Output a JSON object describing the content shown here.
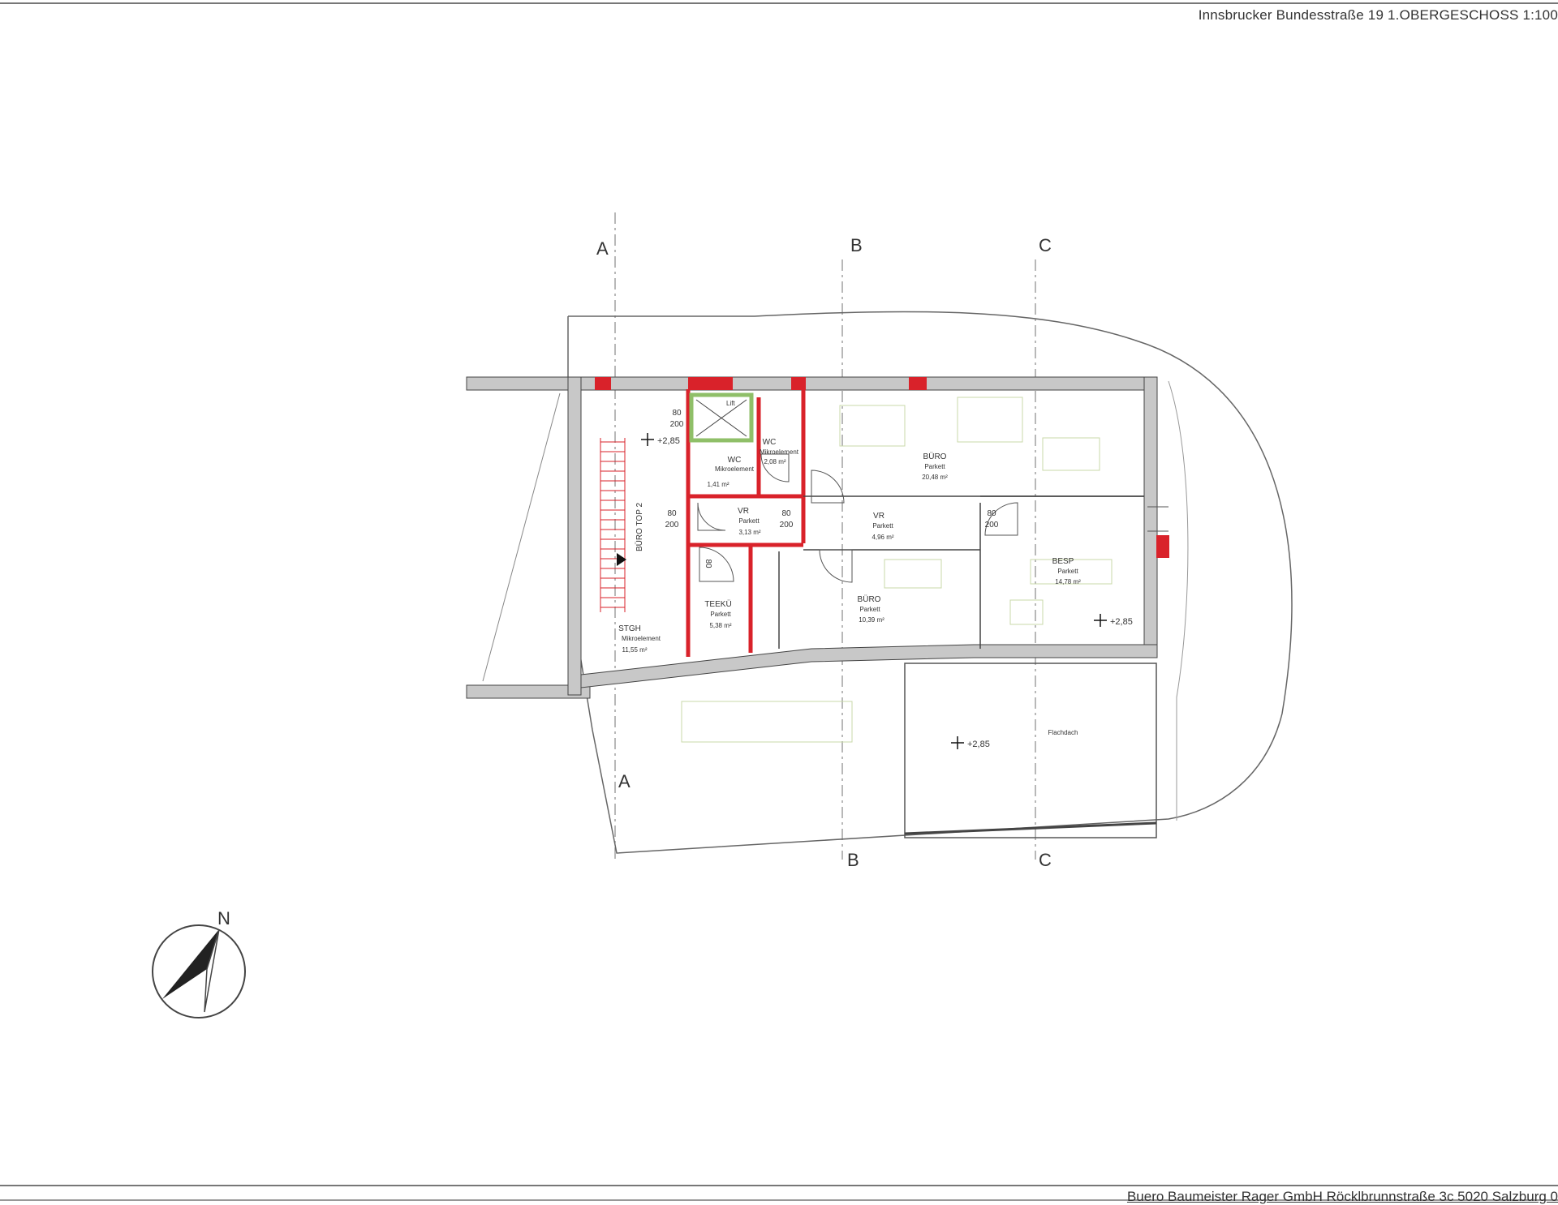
{
  "header": {
    "text": "Innsbrucker Bundesstraße 19  1.OBERGESCHOSS 1:100"
  },
  "footer": {
    "text": "Buero Baumeister Rager GmbH Röcklbrunnstraße 3c  5020 Salzburg  0"
  },
  "section_marks": {
    "a": "A",
    "b": "B",
    "c": "C"
  },
  "unit_label": "BÜRO TOP 2",
  "rooms": {
    "lift": {
      "name": "Lift"
    },
    "wc1": {
      "name": "WC",
      "floor": "Mikroelement",
      "area": "1,41 m²"
    },
    "wc2": {
      "name": "WC",
      "floor": "Mikroelement",
      "area": "2,08 m²"
    },
    "buero1": {
      "name": "BÜRO",
      "floor": "Parkett",
      "area": "20,48 m²"
    },
    "vr1": {
      "name": "VR",
      "floor": "Parkett",
      "area": "3,13 m²"
    },
    "vr2": {
      "name": "VR",
      "floor": "Parkett",
      "area": "4,96 m²"
    },
    "besp": {
      "name": "BESP",
      "floor": "Parkett",
      "area": "14,78 m²"
    },
    "teeku": {
      "name": "TEEKÜ",
      "floor": "Parkett",
      "area": "5,38 m²"
    },
    "buero2": {
      "name": "BÜRO",
      "floor": "Parkett",
      "area": "10,39 m²"
    },
    "stgh": {
      "name": "STGH",
      "floor": "Mikroelement",
      "area": "11,55 m²"
    },
    "flachdach": {
      "name": "Flachdach"
    }
  },
  "door_labels": {
    "d1_top": "80",
    "d1_bot": "200",
    "d2_top": "80",
    "d2_bot": "200",
    "d3_top": "80",
    "d3_bot": "200",
    "d4_top": "80",
    "d4_bot": "200",
    "d5": "80"
  },
  "levels": {
    "l1": "+2,85",
    "l2": "+2,85",
    "l3": "+2,85"
  },
  "north": {
    "label": "N"
  },
  "colors": {
    "wall_existing": "#c8c8c8",
    "wall_new": "#d9222a",
    "lift_frame": "#8fbf68",
    "lines": "#555555"
  }
}
